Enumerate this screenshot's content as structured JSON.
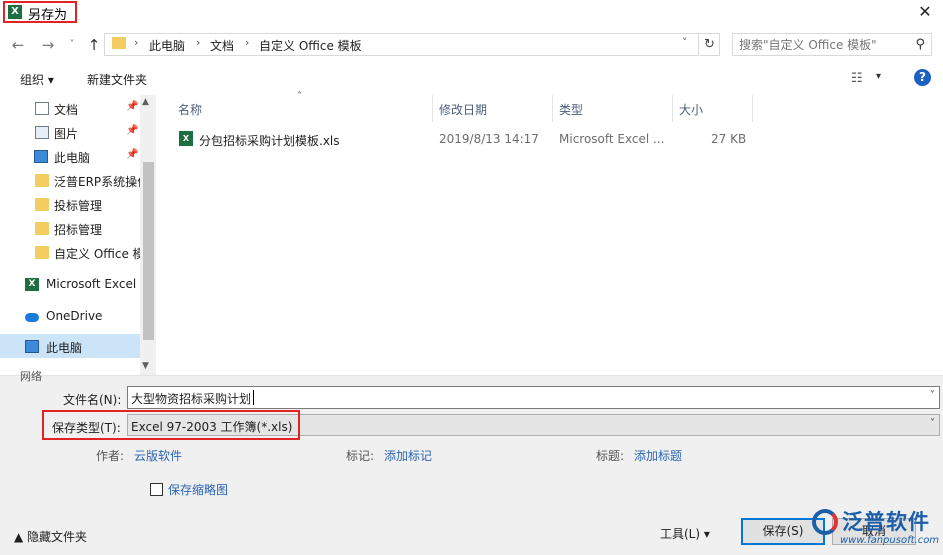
{
  "window": {
    "title": "另存为",
    "close_glyph": "✕",
    "icon": "excel-icon"
  },
  "nav": {
    "back_glyph": "←",
    "forward_glyph": "→",
    "recent_glyph": "˅",
    "up_glyph": "↑",
    "breadcrumb": [
      "此电脑",
      "文档",
      "自定义 Office 模板"
    ],
    "separator": "›",
    "dropdown_glyph": "˅",
    "refresh_glyph": "↻",
    "search_placeholder": "搜索\"自定义 Office 模板\"",
    "search_glyph": "⚲"
  },
  "toolbar": {
    "organize_label": "组织 ▾",
    "new_folder_label": "新建文件夹",
    "view_glyph": "☷",
    "view_dropdown_glyph": "▾",
    "help_glyph": "?"
  },
  "sidebar": {
    "pin_glyph": "📌",
    "items": [
      {
        "label": "文档",
        "icon": "document-icon",
        "pinned": true
      },
      {
        "label": "图片",
        "icon": "picture-icon",
        "pinned": true
      },
      {
        "label": "此电脑",
        "icon": "computer-icon",
        "pinned": true
      },
      {
        "label": "泛普ERP系统操作",
        "icon": "folder-icon",
        "pinned": false
      },
      {
        "label": "投标管理",
        "icon": "folder-icon",
        "pinned": false
      },
      {
        "label": "招标管理",
        "icon": "folder-icon",
        "pinned": false
      },
      {
        "label": "自定义 Office 模板",
        "icon": "folder-icon",
        "pinned": false
      },
      {
        "label": "Microsoft Excel",
        "icon": "excel-icon",
        "pinned": false
      },
      {
        "label": "OneDrive",
        "icon": "cloud-icon",
        "pinned": false
      },
      {
        "label": "此电脑",
        "icon": "computer-icon",
        "pinned": false,
        "selected": true
      }
    ],
    "partial_item": "网络"
  },
  "filelist": {
    "sort_glyph": "˄",
    "columns": [
      "名称",
      "修改日期",
      "类型",
      "大小"
    ],
    "rows": [
      {
        "name": "分包招标采购计划模板.xls",
        "modified": "2019/8/13 14:17",
        "type": "Microsoft Excel ...",
        "size": "27 KB",
        "icon": "excel-file-icon"
      }
    ]
  },
  "form": {
    "filename_label": "文件名(N):",
    "filename_value": "大型物资招标采购计划",
    "filetype_label": "保存类型(T):",
    "filetype_value": "Excel 97-2003 工作簿(*.xls)",
    "dropdown_glyph": "˅",
    "author_label": "作者:",
    "author_value": "云版软件",
    "tags_label": "标记:",
    "tags_value": "添加标记",
    "title_label": "标题:",
    "title_value": "添加标题",
    "thumbnail_label": "保存缩略图",
    "thumbnail_checked": false
  },
  "footer": {
    "hide_folders_label": "▲  隐藏文件夹",
    "tools_label": "工具(L)   ▾",
    "save_label": "保存(S)",
    "cancel_label": "取消"
  },
  "watermark": {
    "text": "泛普软件",
    "url": "www.fanpusoft.com"
  },
  "colors": {
    "highlight_red": "#e02424",
    "selection_blue": "#cce4f7",
    "link_blue": "#2a65b3",
    "excel_green": "#1d6f42"
  }
}
